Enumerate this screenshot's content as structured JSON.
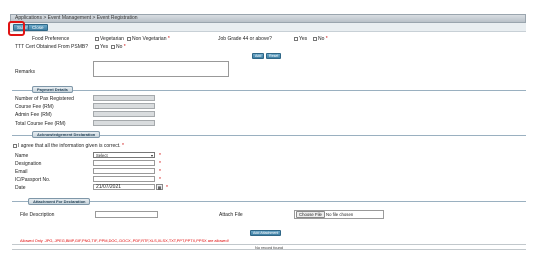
{
  "breadcrumb": "Applications > Event Management > Event Registration",
  "toolbar": {
    "submit_label": "Submit",
    "close_label": "Close"
  },
  "food": {
    "label": "Food Preference",
    "veg_label": "Vegetarian",
    "nonveg_label": "Non Vegetarian",
    "req": "*"
  },
  "grade": {
    "label": "Job Grade 44 or above?",
    "yes_label": "Yes",
    "no_label": "No",
    "req": "*"
  },
  "ttt": {
    "label": "TTT Cert Obtained From PSMB?",
    "yes_label": "Yes",
    "no_label": "No",
    "req": "*"
  },
  "actions": {
    "add_label": "Add",
    "reset_label": "Reset"
  },
  "remarks": {
    "label": "Remarks"
  },
  "payment": {
    "title": "Payment Details",
    "pax_label": "Number of Pax Registered",
    "course_fee_label": "Course Fee (RM)",
    "admin_fee_label": "Admin Fee (RM)",
    "total_fee_label": "Total Course Fee (RM)"
  },
  "ack": {
    "title": "Acknowledgement Declaration",
    "agree_label": "I agree that all the information given is correct.",
    "req": "*",
    "name_label": "Name",
    "name_value": "Select",
    "designation_label": "Designation",
    "email_label": "Email",
    "ic_label": "IC/Passport No.",
    "date_label": "Date",
    "date_value": "21/07/2021"
  },
  "attachment": {
    "title": "Attachment For Declaration",
    "desc_label": "File Description",
    "attach_label": "Attach File",
    "choose_label": "Choose File",
    "no_file_label": "No file chosen",
    "add_button_label": "Add Attachment",
    "allowed_text": "Allowed Only .JPG,.JPEG,BMP,GIF,PNG,TIF,.PPM,DOC,.DOCX,.PDF,RTF,XLS,XLSX,TXT,PPT,PPTX,PPSX are allowed!",
    "no_record": "No record found"
  }
}
